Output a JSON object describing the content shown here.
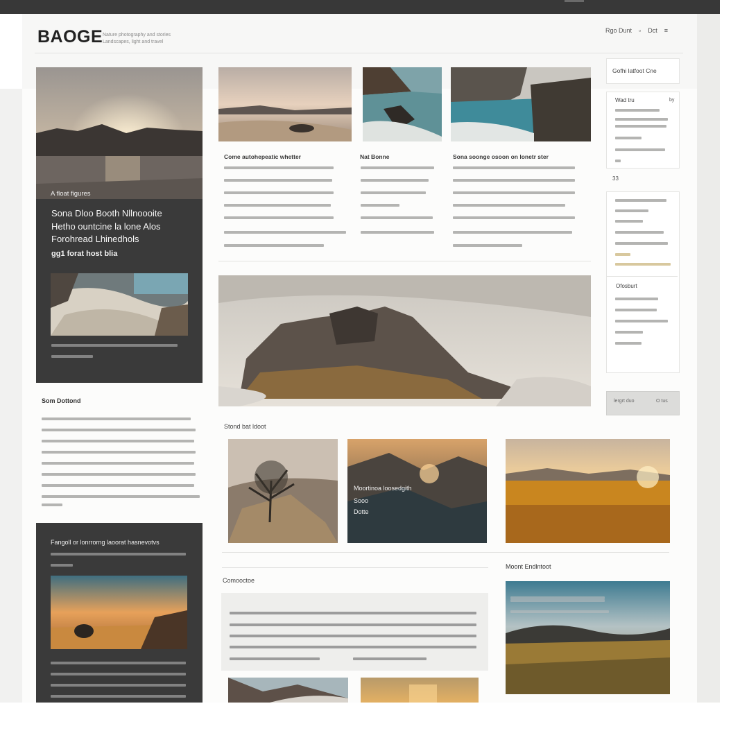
{
  "brand": {
    "logo": "BAOGE",
    "tagline_1": "Nature photography and stories",
    "tagline_2": "Landscapes, light and travel"
  },
  "nav": {
    "item_1": "Rgo Dunt",
    "item_2": "Dct",
    "search_icon": "search-icon",
    "menu_icon": "menu-icon"
  },
  "feature": {
    "overlay_label": "A float figures",
    "headline_1": "Sona Dloo Booth Nllnoooite",
    "headline_2": "Hetho ountcine la lone Alos",
    "headline_3": "Forohread Lhinedhols",
    "subline": "gg1 forat host blia"
  },
  "columns": {
    "col1_title": "Come autohepeatic whetter",
    "col2_title": "Nat Bonne",
    "col3_title": "Sona soonge osoon on lonetr ster"
  },
  "sidebar": {
    "top_label": "Gofhi latfoot Cne",
    "box1_title": "Wad tru",
    "box1_tag": "by",
    "count": "33",
    "box3_title": "Ofosburt",
    "button_left": "lergrt duo",
    "button_right": "O tus"
  },
  "left": {
    "section_title": "Som Dottond",
    "dark_title": "Fangoll or lonrrorng laoorat hasnevotvs"
  },
  "gallery": {
    "title": "Stond bat ldoot",
    "overlay_1": "Moortinoa loosedgith",
    "overlay_2": "Sooo",
    "overlay_3": "Dotte"
  },
  "bottom": {
    "section_title": "Comooctoe",
    "right_title": "Moont Endlntoot"
  },
  "colors": {
    "dark_panel": "#3a3a3a",
    "page_bg": "#fcfcfb",
    "top_bar": "#383838"
  }
}
